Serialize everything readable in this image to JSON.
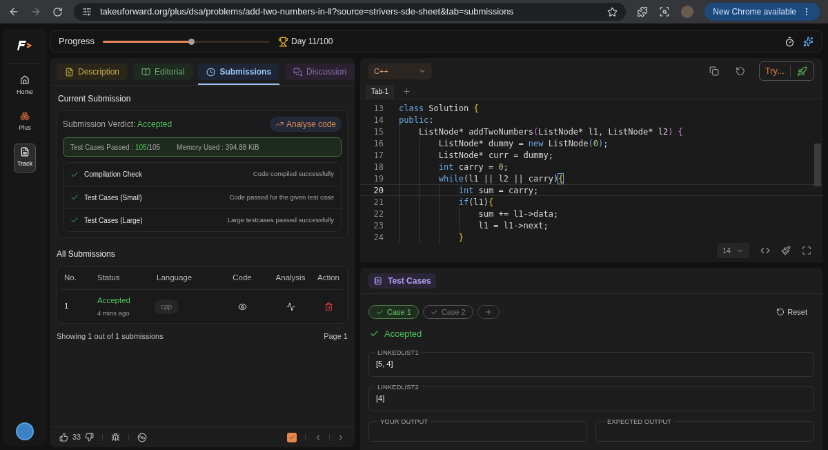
{
  "browser": {
    "url": "takeuforward.org/plus/dsa/problems/add-two-numbers-in-ll?source=strivers-sde-sheet&tab=submissions",
    "update_button": "New Chrome available"
  },
  "sidebar": {
    "items": [
      {
        "label": "Home",
        "selected": false,
        "kind": "home"
      },
      {
        "label": "Plus",
        "selected": false,
        "kind": "plus"
      },
      {
        "label": "Track",
        "selected": true,
        "kind": "track"
      }
    ]
  },
  "progress": {
    "label": "Progress",
    "level": 0.53,
    "day": "Day 11/100"
  },
  "problem_tabs": [
    {
      "label": "Description",
      "selected": false,
      "color": "#c7a94e",
      "kind": "description"
    },
    {
      "label": "Editorial",
      "selected": false,
      "color": "#6fa872",
      "kind": "editorial"
    },
    {
      "label": "Submissions",
      "selected": true,
      "color": "#9cc2f5",
      "kind": "submissions"
    },
    {
      "label": "Discussion",
      "selected": false,
      "color": "#8e6fae",
      "kind": "discussion"
    }
  ],
  "current_submission": {
    "title": "Current Submission",
    "verdict_label": "Submission Verdict: ",
    "verdict": "Accepted",
    "analyse_button": "Analyse code",
    "passed_label": "Test Cases Passed : ",
    "passed": "105",
    "total": "/105",
    "memory": "Memory Used : 394.88 KiB",
    "checks": [
      {
        "name": "Compilation Check",
        "message": "Code compiled successfully",
        "passed": true
      },
      {
        "name": "Test Cases (Small)",
        "message": "Code passed for the given test case",
        "passed": true
      },
      {
        "name": "Test Cases (Large)",
        "message": "Large testcases passed successfully",
        "passed": true
      }
    ]
  },
  "all_submissions": {
    "title": "All Submissions",
    "columns": [
      "No.",
      "Status",
      "Language",
      "Code",
      "Analysis",
      "Action"
    ],
    "rows": [
      {
        "no": "1",
        "status": "Accepted",
        "time": "4 mins ago",
        "language": "cpp"
      }
    ],
    "footer": "Showing 1 out of 1 submissions",
    "page": "Page 1"
  },
  "bottom_bar": {
    "likes": "33",
    "solved": true
  },
  "editor": {
    "language": "C++",
    "try_button": "Try...",
    "tabs": [
      {
        "label": "Tab-1",
        "selected": true
      }
    ],
    "font_size": "14",
    "lines": [
      {
        "number": "13",
        "current": false,
        "tokens": [
          {
            "text": "class",
            "kind": "kw"
          },
          {
            "text": " Solution ",
            "kind": "plain"
          },
          {
            "text": "{",
            "kind": "brace"
          }
        ]
      },
      {
        "number": "14",
        "current": false,
        "tokens": [
          {
            "text": "public",
            "kind": "kw"
          },
          {
            "text": ":",
            "kind": "plain"
          }
        ]
      },
      {
        "number": "15",
        "current": false,
        "tokens": [
          {
            "text": "    ListNode* addTwoNumbers",
            "kind": "plain"
          },
          {
            "text": "(",
            "kind": "paren"
          },
          {
            "text": "ListNode* l1, ListNode* l2",
            "kind": "plain"
          },
          {
            "text": ") {",
            "kind": "paren"
          }
        ]
      },
      {
        "number": "16",
        "current": false,
        "tokens": [
          {
            "text": "        ListNode* dummy = ",
            "kind": "plain"
          },
          {
            "text": "new",
            "kind": "kw"
          },
          {
            "text": " ListNode",
            "kind": "plain"
          },
          {
            "text": "(",
            "kind": "bracket"
          },
          {
            "text": "0",
            "kind": "num"
          },
          {
            "text": ")",
            "kind": "bracket"
          },
          {
            "text": ";",
            "kind": "plain"
          }
        ]
      },
      {
        "number": "17",
        "current": false,
        "tokens": [
          {
            "text": "        ListNode* curr = dummy;",
            "kind": "plain"
          }
        ]
      },
      {
        "number": "18",
        "current": false,
        "tokens": [
          {
            "text": "        int",
            "kind": "kw"
          },
          {
            "text": " carry = ",
            "kind": "plain"
          },
          {
            "text": "0",
            "kind": "num"
          },
          {
            "text": ";",
            "kind": "plain"
          }
        ]
      },
      {
        "number": "19",
        "current": false,
        "tokens": [
          {
            "text": "        while",
            "kind": "kw"
          },
          {
            "text": "(l1 || l2 || carry)",
            "kind": "plain"
          },
          {
            "text": "{",
            "kind": "match"
          }
        ]
      },
      {
        "number": "20",
        "current": true,
        "tokens": [
          {
            "text": "            int",
            "kind": "kw"
          },
          {
            "text": " sum = carry;",
            "kind": "plain"
          }
        ]
      },
      {
        "number": "21",
        "current": false,
        "tokens": [
          {
            "text": "            if",
            "kind": "kw"
          },
          {
            "text": "(l1)",
            "kind": "plain"
          },
          {
            "text": "{",
            "kind": "brace"
          }
        ]
      },
      {
        "number": "22",
        "current": false,
        "tokens": [
          {
            "text": "                sum += l1->data;",
            "kind": "plain"
          }
        ]
      },
      {
        "number": "23",
        "current": false,
        "tokens": [
          {
            "text": "                l1 = l1->next;",
            "kind": "plain"
          }
        ]
      },
      {
        "number": "24",
        "current": false,
        "tokens": [
          {
            "text": "            }",
            "kind": "brace"
          }
        ]
      }
    ]
  },
  "test_cases": {
    "title": "Test Cases",
    "cases": [
      {
        "label": "Case 1",
        "selected": true,
        "passed": true
      },
      {
        "label": "Case 2",
        "selected": false,
        "passed": true
      }
    ],
    "reset": "Reset",
    "result": "Accepted",
    "fields": [
      {
        "label": "LINKEDLIST1",
        "value": "[5, 4]"
      },
      {
        "label": "LINKEDLIST2",
        "value": "[4]"
      }
    ],
    "outputs": [
      {
        "label": "YOUR OUTPUT"
      },
      {
        "label": "EXPECTED OUTPUT"
      }
    ]
  }
}
